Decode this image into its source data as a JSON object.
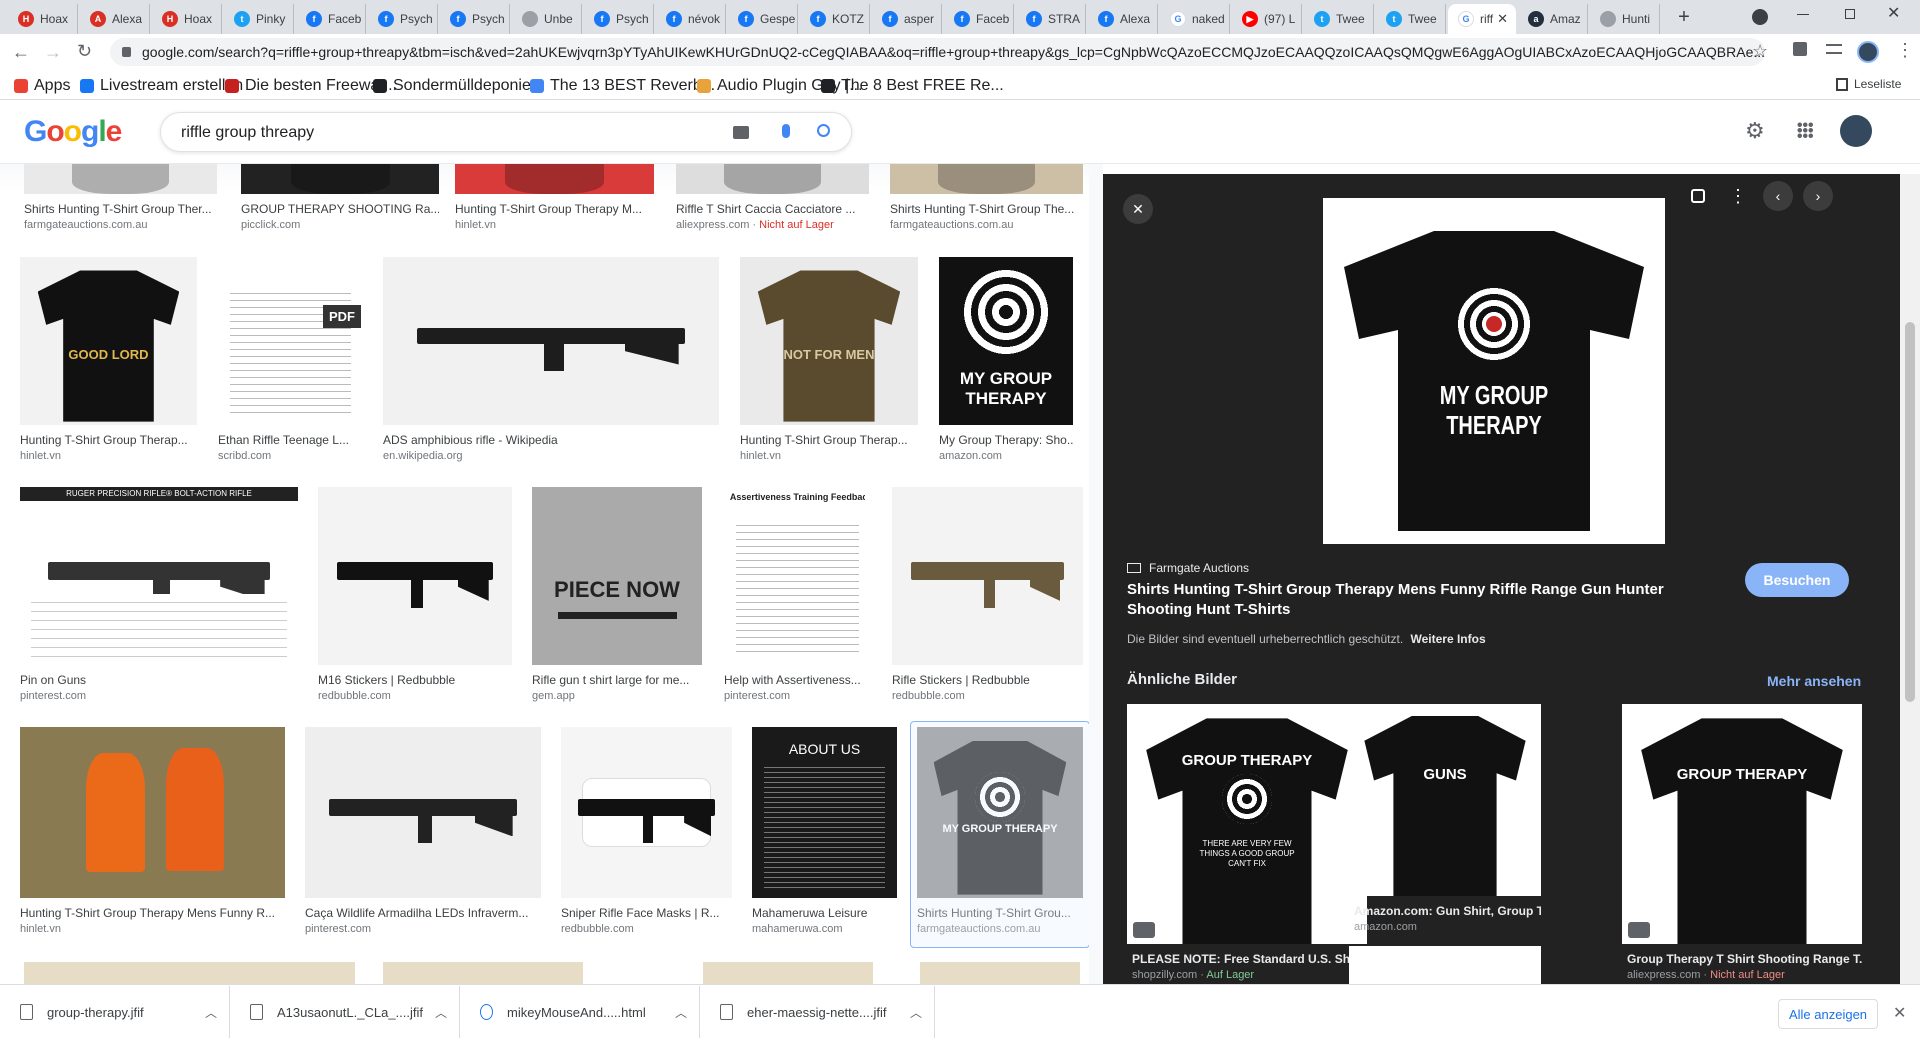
{
  "browser": {
    "tabs": [
      {
        "title": "Hoax",
        "color": "#d93025",
        "glyph": "H"
      },
      {
        "title": "Alexa",
        "color": "#d93025",
        "glyph": "A"
      },
      {
        "title": "Hoax",
        "color": "#d93025",
        "glyph": "H"
      },
      {
        "title": "Pinky",
        "color": "#1da1f2",
        "glyph": "t"
      },
      {
        "title": "Faceb",
        "color": "#1877f2",
        "glyph": "f"
      },
      {
        "title": "Psych",
        "color": "#1877f2",
        "glyph": "f"
      },
      {
        "title": "Psych",
        "color": "#1877f2",
        "glyph": "f"
      },
      {
        "title": "Unbe",
        "color": "#9aa0a6",
        "glyph": ""
      },
      {
        "title": "Psych",
        "color": "#1877f2",
        "glyph": "f"
      },
      {
        "title": "névok",
        "color": "#1877f2",
        "glyph": "f"
      },
      {
        "title": "Gespe",
        "color": "#1877f2",
        "glyph": "f"
      },
      {
        "title": "KOTZ",
        "color": "#1877f2",
        "glyph": "f"
      },
      {
        "title": "asper",
        "color": "#1877f2",
        "glyph": "f"
      },
      {
        "title": "Faceb",
        "color": "#1877f2",
        "glyph": "f"
      },
      {
        "title": "STRA",
        "color": "#1877f2",
        "glyph": "f"
      },
      {
        "title": "Alexa",
        "color": "#1877f2",
        "glyph": "f"
      },
      {
        "title": "naked",
        "color": "#ffffff",
        "glyph": "G"
      },
      {
        "title": "(97) L",
        "color": "#ff0000",
        "glyph": "▶"
      },
      {
        "title": "Twee",
        "color": "#1da1f2",
        "glyph": "t"
      },
      {
        "title": "Twee",
        "color": "#1da1f2",
        "glyph": "t"
      },
      {
        "title": "riff",
        "color": "#ffffff",
        "glyph": "G",
        "active": true
      },
      {
        "title": "Amaz",
        "color": "#232f3e",
        "glyph": "a"
      },
      {
        "title": "Hunti",
        "color": "#9aa0a6",
        "glyph": ""
      }
    ],
    "url": "google.com/search?q=riffle+group+threapy&tbm=isch&ved=2ahUKEwjvqrn3pYTyAhUIKewKHUrGDnUQ2-cCegQIABAA&oq=riffle+group+threapy&gs_lcp=CgNpbWcQAzoECCMQJzoECAAQQzoICAAQsQMQgwE6AggAOgUIABCxAzoECAAQHjoGCAAQBRAe...",
    "bookmarks": [
      {
        "label": "Apps",
        "color": "#ea4335"
      },
      {
        "label": "Livestream erstellen",
        "color": "#1877f2"
      },
      {
        "label": "Die besten Freewar...",
        "color": "#c5221f"
      },
      {
        "label": "Sondermülldeponie...",
        "color": "#202124"
      },
      {
        "label": "The 13 BEST Reverb...",
        "color": "#4285f4"
      },
      {
        "label": "Audio Plugin Guy |...",
        "color": "#e8a33d"
      },
      {
        "label": "The 8 Best FREE Re...",
        "color": "#202124"
      }
    ],
    "reading_list": "Leseliste"
  },
  "search": {
    "query": "riffle group threapy"
  },
  "grid": [
    {
      "caption": "Shirts Hunting T-Shirt Group Ther...",
      "source": "farmgateauctions.com.au"
    },
    {
      "caption": "GROUP THERAPY SHOOTING Ra...",
      "source": "picclick.com"
    },
    {
      "caption": "Hunting T-Shirt Group Therapy M...",
      "source": "hinlet.vn"
    },
    {
      "caption": "Riffle T Shirt Caccia Cacciatore ...",
      "source": "aliexpress.com",
      "stock": "Nicht auf Lager"
    },
    {
      "caption": "Shirts Hunting T-Shirt Group The...",
      "source": "farmgateauctions.com.au"
    },
    {
      "caption": "Hunting T-Shirt Group Therap...",
      "source": "hinlet.vn",
      "shirt_line1": "GOOD LORD"
    },
    {
      "caption": "Ethan Riffle Teenage L...",
      "source": "scribd.com",
      "badge": "PDF"
    },
    {
      "caption": "ADS amphibious rifle - Wikipedia",
      "source": "en.wikipedia.org"
    },
    {
      "caption": "Hunting T-Shirt Group Therap...",
      "source": "hinlet.vn",
      "shirt_line1": "NOT FOR MEN"
    },
    {
      "caption": "My Group Therapy: Sho...",
      "source": "amazon.com",
      "shirt_text": "MY GROUP THERAPY"
    },
    {
      "caption": "Pin on Guns",
      "source": "pinterest.com",
      "sheet_title": "RUGER PRECISION RIFLE® BOLT-ACTION RIFLE"
    },
    {
      "caption": "M16 Stickers | Redbubble",
      "source": "redbubble.com"
    },
    {
      "caption": "Rifle gun t shirt large for me...",
      "source": "gem.app",
      "shirt_text": "PIECE NOW"
    },
    {
      "caption": "Help with Assertiveness...",
      "source": "pinterest.com",
      "sheet_title": "Assertiveness Training Feedback Chart"
    },
    {
      "caption": "Rifle Stickers | Redbubble",
      "source": "redbubble.com"
    },
    {
      "caption": "Hunting T-Shirt Group Therapy Mens Funny R...",
      "source": "hinlet.vn"
    },
    {
      "caption": "Caça Wildlife Armadilha LEDs Infraverm...",
      "source": "pinterest.com"
    },
    {
      "caption": "Sniper Rifle Face Masks | R...",
      "source": "redbubble.com"
    },
    {
      "caption": "Mahameruwa Leisure",
      "source": "mahameruwa.com",
      "sheet_title": "ABOUT US"
    },
    {
      "caption": "Shirts Hunting T-Shirt Grou...",
      "source": "farmgateauctions.com.au",
      "shirt_text": "MY GROUP THERAPY"
    }
  ],
  "panel": {
    "shirt_text": "MY GROUP THERAPY",
    "source": "Farmgate Auctions",
    "title": "Shirts Hunting T-Shirt Group Therapy Mens Funny Riffle Range Gun Hunter Shooting Hunt T-Shirts",
    "visit": "Besuchen",
    "copyright": "Die Bilder sind eventuell urheberrechtlich geschützt.",
    "more_info": "Weitere Infos",
    "related_title": "Ähnliche Bilder",
    "see_more": "Mehr ansehen",
    "related": [
      {
        "caption": "PLEASE NOTE: Free Standard U.S. Shipp...",
        "source": "shopzilly.com",
        "stock": "Auf Lager",
        "shirt_text": "GROUP THERAPY",
        "shirt_sub": "THERE ARE VERY FEW THINGS A GOOD GROUP CAN'T FIX"
      },
      {
        "caption": "Amazon.com: Gun Shirt, Group Therapy ...",
        "source": "amazon.com",
        "shirt_text": "GUNS"
      },
      {
        "caption": "Group Therapy T Shirt Shooting Range T...",
        "source": "aliexpress.com",
        "stock": "Nicht auf Lager",
        "shirt_text": "GROUP THERAPY"
      }
    ]
  },
  "downloads": {
    "items": [
      "group-therapy.jfif",
      "A13usaonutL._CLa_....jfif",
      "mikeyMouseAnd.....html",
      "eher-maessig-nette....jfif"
    ],
    "show_all": "Alle anzeigen"
  }
}
